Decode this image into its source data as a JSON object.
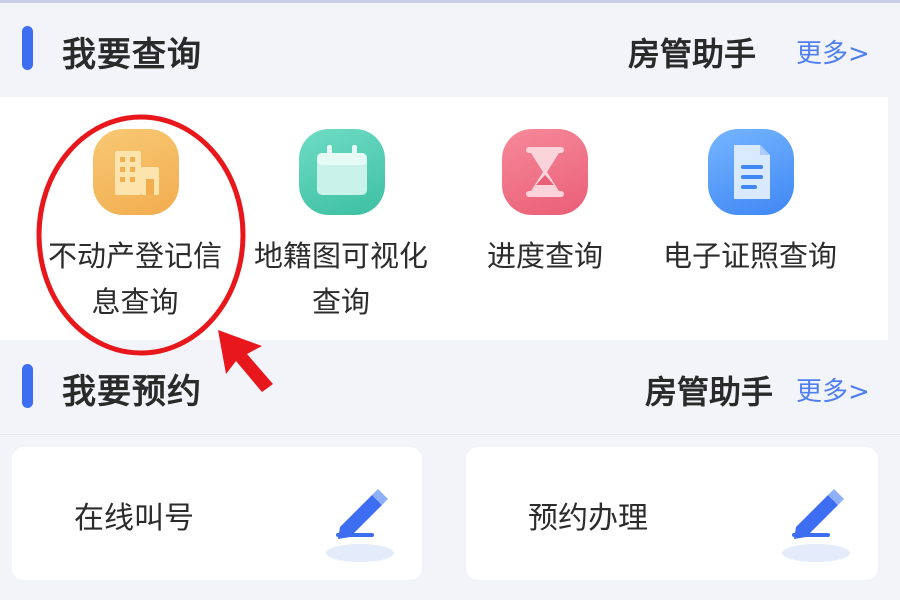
{
  "query_section": {
    "title": "我要查询",
    "assistant": "房管助手",
    "more": "更多>",
    "items": [
      {
        "label": "不动产登记信息查询",
        "icon": "building-icon",
        "color": "#f3b257"
      },
      {
        "label": "地籍图可视化查询",
        "icon": "calendar-icon",
        "color": "#48c6aa"
      },
      {
        "label": "进度查询",
        "icon": "hourglass-icon",
        "color": "#ee6a80"
      },
      {
        "label": "电子证照查询",
        "icon": "document-icon",
        "color": "#4a8ff6"
      }
    ]
  },
  "appointment_section": {
    "title": "我要预约",
    "assistant": "房管助手",
    "more": "更多>",
    "cards": [
      {
        "label": "在线叫号",
        "icon": "pen-icon"
      },
      {
        "label": "预约办理",
        "icon": "pen-icon"
      }
    ]
  },
  "colors": {
    "accent": "#3d6ef2",
    "link": "#4f7ff0",
    "annotation": "#e8171b",
    "background": "#f3f4f9"
  }
}
